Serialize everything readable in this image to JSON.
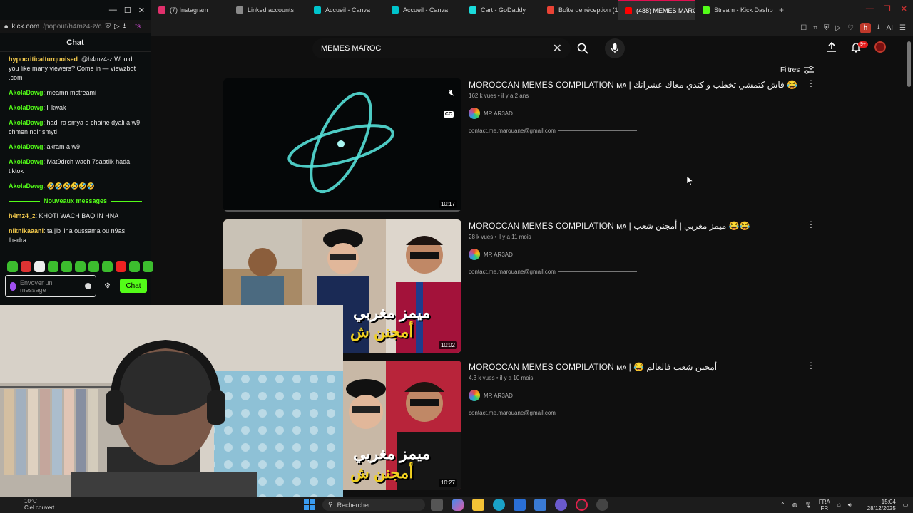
{
  "browser": {
    "tabs": [
      {
        "label": "(7) Instagram",
        "color": "#e1306c",
        "active": false
      },
      {
        "label": "Linked accounts",
        "color": "#8a8a8a",
        "active": false
      },
      {
        "label": "Accueil - Canva",
        "color": "#00c4cc",
        "active": false
      },
      {
        "label": "Accueil - Canva",
        "color": "#00c4cc",
        "active": false
      },
      {
        "label": "Cart - GoDaddy",
        "color": "#1bdbdb",
        "active": false
      },
      {
        "label": "Boîte de réception (1",
        "color": "#ea4335",
        "active": false
      },
      {
        "label": "(488) MEMES MAROC - Y",
        "color": "#ff0000",
        "active": true
      },
      {
        "label": "Stream - Kick Dashbo",
        "color": "#53fc18",
        "active": false
      }
    ],
    "new_tab": "+",
    "profile_letter": "h",
    "ai_label": "AI"
  },
  "kick": {
    "url_host": "kick.com",
    "url_path": "/popout/h4mz4-z/c",
    "url_suffix": "ts",
    "chat_title": "Chat",
    "messages": [
      {
        "user": "hypocriticalturquoised",
        "user_color": "#f2c94c",
        "text": "@h4mz4-z Would you like many viewers? Come in — viewzbot .com"
      },
      {
        "user": "AkolaDawg",
        "user_color": "#53fc18",
        "text": "meamn mstreami"
      },
      {
        "user": "AkolaDawg",
        "user_color": "#53fc18",
        "text": "ll kwak"
      },
      {
        "user": "AkolaDawg",
        "user_color": "#53fc18",
        "text": "hadi ra smya d chaine dyali a w9 chmen ndir smyti"
      },
      {
        "user": "AkolaDawg",
        "user_color": "#53fc18",
        "text": "akram a w9"
      },
      {
        "user": "AkolaDawg",
        "user_color": "#53fc18",
        "text": "Mat9drch wach 7sabtlik hada tiktok"
      },
      {
        "user": "AkolaDawg",
        "user_color": "#53fc18",
        "text": "🤣🤣🤣🤣🤣🤣"
      }
    ],
    "divider_label": "Nouveaux messages",
    "messages_after": [
      {
        "user": "h4mz4_z",
        "user_color": "#f2c94c",
        "text": "KHOTI WACH BAQIIN HNA"
      },
      {
        "user": "nlknlkaaanl",
        "user_color": "#f2c94c",
        "text": "ta jib lina oussama ou n9as lhadra"
      }
    ],
    "input_placeholder": "Envoyer un message",
    "chat_button": "Chat"
  },
  "youtube": {
    "search_value": "MEMES MAROC",
    "notification_count": "9+",
    "filters_label": "Filtres",
    "results": [
      {
        "title": "MOROCCAN MEMES COMPILATION ᴍᴀ | فاش كتمشي تخطب و كتدي معاك عشرانك 😂",
        "views": "162 k vues",
        "age": "il y a 2 ans",
        "channel": "MR AR3AD",
        "description": "contact.me.marouane@gmail.com",
        "duration": "10:17"
      },
      {
        "title": "MOROCCAN MEMES COMPILATION ᴍᴀ | ميمز مغربي | أمجنن شعب 😂😂",
        "views": "28 k vues",
        "age": "il y a 11 mois",
        "channel": "MR AR3AD",
        "description": "contact.me.marouane@gmail.com",
        "duration": "10:02"
      },
      {
        "title": "MOROCCAN MEMES COMPILATION ᴍᴀ | 😂 أمجنن شعب فالعالم",
        "views": "4,3 k vues",
        "age": "il y a 10 mois",
        "channel": "MR AR3AD",
        "description": "contact.me.marouane@gmail.com",
        "duration": "10:27"
      }
    ],
    "thumb_overlay_text_1": "ميمز مغربي",
    "thumb_overlay_text_2": "أمجنن ش"
  },
  "taskbar": {
    "weather_temp": "10°C",
    "weather_text": "Ciel couvert",
    "search_placeholder": "Rechercher",
    "lang_1": "FRA",
    "lang_2": "FR",
    "time": "15:04",
    "date": "28/12/2025"
  }
}
